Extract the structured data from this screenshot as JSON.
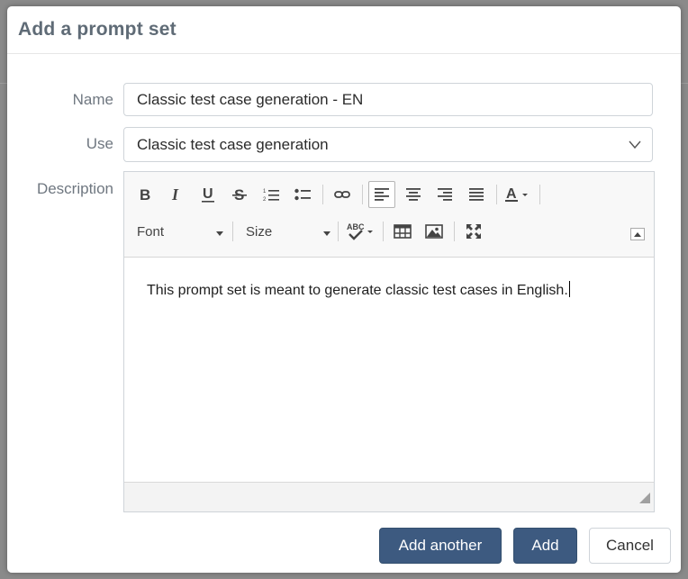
{
  "dialog": {
    "title": "Add a prompt set"
  },
  "form": {
    "name_label": "Name",
    "name_value": "Classic test case generation - EN",
    "use_label": "Use",
    "use_value": "Classic test case generation",
    "description_label": "Description"
  },
  "editor": {
    "font_label": "Font",
    "size_label": "Size",
    "content": "This prompt set is meant to generate classic test cases in English."
  },
  "buttons": {
    "add_another": "Add another",
    "add": "Add",
    "cancel": "Cancel"
  },
  "colors": {
    "primary": "#3d5a80",
    "title": "#5f6b76",
    "label": "#6f7780"
  }
}
